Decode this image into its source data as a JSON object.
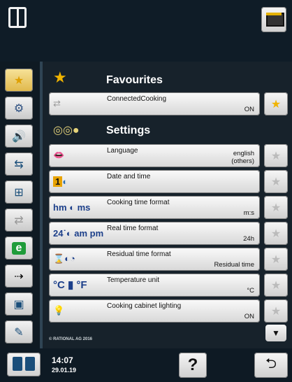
{
  "header": {
    "left_icon": "oven-door-icon",
    "right_icon": "screen-button-icon"
  },
  "sidebar": {
    "items": [
      {
        "name": "favourites",
        "icon": "star-icon",
        "glyph": "★",
        "active": true
      },
      {
        "name": "settings",
        "icon": "settings-icon",
        "glyph": "⚙"
      },
      {
        "name": "audio",
        "icon": "audio-icon",
        "glyph": "🔊"
      },
      {
        "name": "network",
        "icon": "network-icon",
        "glyph": "⇆"
      },
      {
        "name": "lan",
        "icon": "lan-icon",
        "glyph": "⊞"
      },
      {
        "name": "share",
        "icon": "share-icon",
        "glyph": "⇄"
      },
      {
        "name": "eco",
        "icon": "eco-icon",
        "glyph": "e"
      },
      {
        "name": "favourites-export",
        "icon": "export-icon",
        "glyph": "⇢"
      },
      {
        "name": "monitor",
        "icon": "monitor-icon",
        "glyph": "▣"
      },
      {
        "name": "service",
        "icon": "wrench-icon",
        "glyph": "✎"
      }
    ]
  },
  "favourites": {
    "title": "Favourites",
    "rows": [
      {
        "label": "ConnectedCooking",
        "value": "ON",
        "icon": "share-icon",
        "glyph": "⇄",
        "fav": true
      }
    ]
  },
  "settings": {
    "title": "Settings",
    "rows": [
      {
        "label": "Language",
        "value": "english",
        "value2": "(others)",
        "icon": "lips-icon",
        "glyph": "👄"
      },
      {
        "label": "Date and time",
        "value": "",
        "icon": "calendar-globe-icon",
        "glyph": "1"
      },
      {
        "label": "Cooking time format",
        "value": "m:s",
        "icon": "hm-ms-icon",
        "glyph": "hm ◐ ms"
      },
      {
        "label": "Real time format",
        "value": "24h",
        "icon": "24-ampm-icon",
        "glyph": "24˙◐ am pm"
      },
      {
        "label": "Residual time format",
        "value": "Residual time",
        "icon": "hourglass-icon",
        "glyph": "⌛◐◔"
      },
      {
        "label": "Temperature unit",
        "value": "°C",
        "icon": "thermometer-icon",
        "glyph": "°C ▮ °F"
      },
      {
        "label": "Cooking cabinet lighting",
        "value": "ON",
        "icon": "lightbulb-icon",
        "glyph": "💡"
      }
    ]
  },
  "footer": {
    "copyright": "© RATIONAL AG 2016",
    "time": "14:07",
    "date": "29.01.19",
    "help_label": "?",
    "back_glyph": "⮌",
    "down_glyph": "▼"
  },
  "colors": {
    "accent": "#f0b400",
    "background": "#17222b",
    "sidebar": "#0f1a23"
  }
}
